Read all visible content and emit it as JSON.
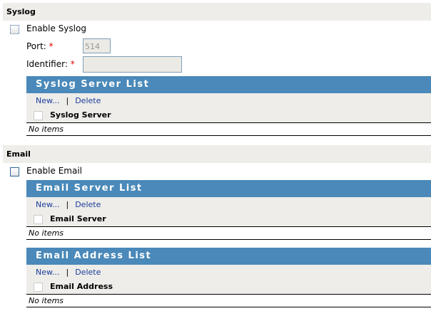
{
  "syslog": {
    "title": "Syslog",
    "enable_label": "Enable Syslog",
    "port_label": "Port:",
    "port_value": "514",
    "identifier_label": "Identifier:",
    "identifier_value": "",
    "required_mark": "*",
    "list": {
      "title": "Syslog Server List",
      "new": "New...",
      "sep": "|",
      "delete": "Delete",
      "column": "Syslog Server",
      "empty": "No items"
    }
  },
  "email": {
    "title": "Email",
    "enable_label": "Enable Email",
    "server_list": {
      "title": "Email Server List",
      "new": "New...",
      "sep": "|",
      "delete": "Delete",
      "column": "Email Server",
      "empty": "No items"
    },
    "address_list": {
      "title": "Email Address List",
      "new": "New...",
      "sep": "|",
      "delete": "Delete",
      "column": "Email Address",
      "empty": "No items"
    }
  }
}
